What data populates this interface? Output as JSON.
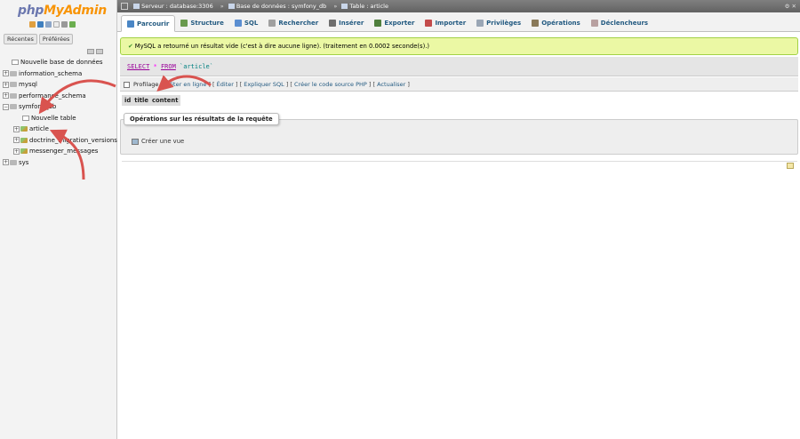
{
  "logo": {
    "part1": "php",
    "part2": "MyAdmin"
  },
  "sidebar": {
    "tabs": [
      "Récentes",
      "Préférées"
    ],
    "tree": [
      {
        "label": "Nouvelle base de données",
        "level": 0,
        "kind": "new"
      },
      {
        "label": "information_schema",
        "level": 0,
        "kind": "db"
      },
      {
        "label": "mysql",
        "level": 0,
        "kind": "db"
      },
      {
        "label": "performance_schema",
        "level": 0,
        "kind": "db"
      },
      {
        "label": "symfony_db",
        "level": 0,
        "kind": "db"
      },
      {
        "label": "Nouvelle table",
        "level": 1,
        "kind": "new"
      },
      {
        "label": "article",
        "level": 1,
        "kind": "table"
      },
      {
        "label": "doctrine_migration_versions",
        "level": 1,
        "kind": "table"
      },
      {
        "label": "messenger_messages",
        "level": 1,
        "kind": "table"
      },
      {
        "label": "sys",
        "level": 0,
        "kind": "db"
      }
    ]
  },
  "breadcrumb": {
    "server": "Serveur : database:3306",
    "database": "Base de données : symfony_db",
    "table": "Table : article"
  },
  "tabs": [
    {
      "label": "Parcourir",
      "active": true,
      "color": "#4a86c5"
    },
    {
      "label": "Structure",
      "active": false,
      "color": "#6a9a4e"
    },
    {
      "label": "SQL",
      "active": false,
      "color": "#5b8ed1"
    },
    {
      "label": "Rechercher",
      "active": false,
      "color": "#a0a0a0"
    },
    {
      "label": "Insérer",
      "active": false,
      "color": "#6e6e6e"
    },
    {
      "label": "Exporter",
      "active": false,
      "color": "#4f7f3d"
    },
    {
      "label": "Importer",
      "active": false,
      "color": "#c34b4b"
    },
    {
      "label": "Privilèges",
      "active": false,
      "color": "#9aa6b5"
    },
    {
      "label": "Opérations",
      "active": false,
      "color": "#8a7a5a"
    },
    {
      "label": "Déclencheurs",
      "active": false,
      "color": "#b8a0a0"
    }
  ],
  "message": {
    "text": "MySQL a retourné un résultat vide (c'est à dire aucune ligne). (traitement en 0.0002 seconde(s).)"
  },
  "sql": {
    "select": "SELECT",
    "star": "*",
    "from": "FROM",
    "table": "`article`"
  },
  "profiling": {
    "label": "Profilage",
    "links": [
      "Éditer en ligne",
      "Éditer",
      "Expliquer SQL",
      "Créer le code source PHP",
      "Actualiser"
    ]
  },
  "columns": [
    "id",
    "title",
    "content"
  ],
  "operations": {
    "legend": "Opérations sur les résultats de la requête",
    "create_view": "Créer une vue"
  },
  "colors": {
    "arrow": "#d9534f",
    "success_bg": "#ebf8a4",
    "link": "#235a81"
  }
}
